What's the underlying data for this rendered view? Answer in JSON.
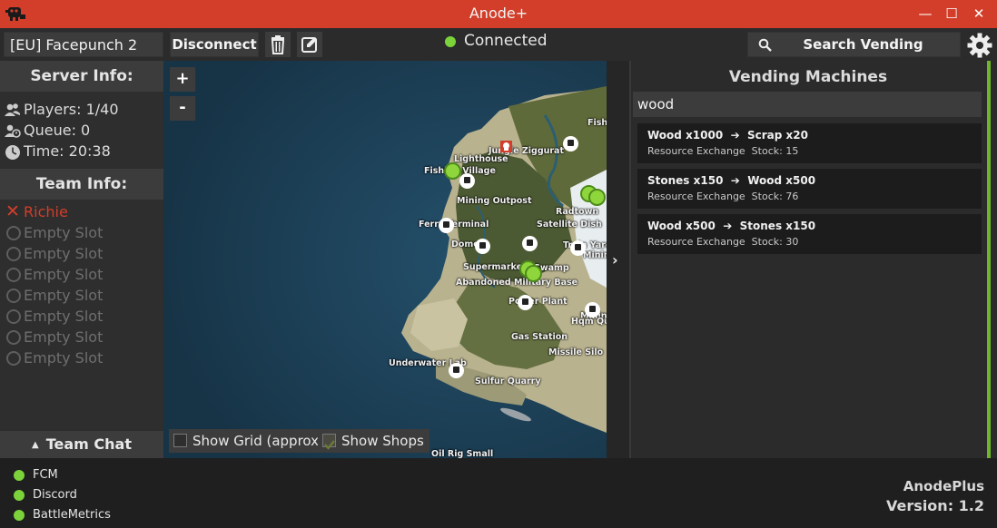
{
  "window": {
    "title": "Anode+",
    "minimize": "—",
    "maximize": "☐",
    "close": "✕"
  },
  "toolbar": {
    "server_name": "[EU] Facepunch 2",
    "disconnect_label": "Disconnect",
    "connection_status": "Connected",
    "search_vending_label": "Search Vending Machines",
    "status_color": "#7bd23b"
  },
  "server_info": {
    "header": "Server Info:",
    "players": "Players: 1/40",
    "queue": "Queue: 0",
    "time": "Time: 20:38"
  },
  "team_info": {
    "header": "Team Info:",
    "members": [
      {
        "name": "Richie",
        "status": "dead"
      },
      {
        "name": "Empty Slot"
      },
      {
        "name": "Empty Slot"
      },
      {
        "name": "Empty Slot"
      },
      {
        "name": "Empty Slot"
      },
      {
        "name": "Empty Slot"
      },
      {
        "name": "Empty Slot"
      },
      {
        "name": "Empty Slot"
      }
    ],
    "chat_label": "Team Chat",
    "chat_arrow": "▲"
  },
  "map": {
    "zoom_in": "+",
    "zoom_out": "-",
    "show_grid_label": "Show Grid (approx)",
    "show_shops_label": "Show Shops",
    "show_grid_checked": false,
    "show_shops_checked": true,
    "labels": [
      "Fishi",
      "Jungle Ziggurat",
      "Lighthouse",
      "Fishing Village",
      "Radtown",
      "Mining Outpost",
      "Satellite Dish",
      "Ferry Terminal",
      "Dome",
      "Train Yard",
      "Mining",
      "Supermarket",
      "Swamp",
      "Abandoned Military Base",
      "Power Plant",
      "Mining",
      "Hqm Qu",
      "Gas Station",
      "Missile Silo",
      "Underwater Lab",
      "Sulfur Quarry",
      "Oil Rig Small"
    ],
    "colors": {
      "water": "#1d3e56",
      "land": "#c9c3a2",
      "forest": "#56663a",
      "shop": "#8fd63c"
    }
  },
  "vending": {
    "title": "Vending Machines",
    "search_value": "wood",
    "panel_arrow": "›",
    "items": [
      {
        "offer": "Wood x1000",
        "arrow": "➔",
        "price": "Scrap x20",
        "detail": "Resource Exchange  Stock: 15"
      },
      {
        "offer": "Stones x150",
        "arrow": "➔",
        "price": "Wood x500",
        "detail": "Resource Exchange  Stock: 76"
      },
      {
        "offer": "Wood x500",
        "arrow": "➔",
        "price": "Stones x150",
        "detail": "Resource Exchange  Stock: 30"
      }
    ]
  },
  "status_bar": {
    "services": [
      "FCM",
      "Discord",
      "BattleMetrics"
    ],
    "app_name": "AnodePlus",
    "version": "Version: 1.2"
  }
}
